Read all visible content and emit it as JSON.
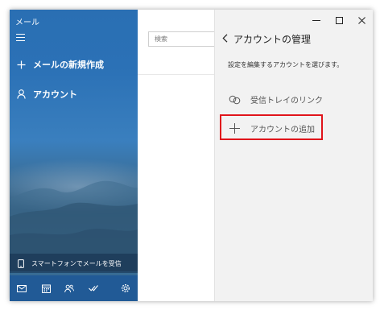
{
  "app": {
    "title": "メール"
  },
  "nav": {
    "compose_label": "メールの新規作成",
    "accounts_label": "アカウント",
    "phone_banner_label": "スマートフォンでメールを受信"
  },
  "search": {
    "placeholder": "検索"
  },
  "flyout": {
    "title": "アカウントの管理",
    "instruction": "設定を編集するアカウントを選びます。",
    "link_inboxes_label": "受信トレイのリンク",
    "add_account_label": "アカウントの追加"
  },
  "window_controls": {
    "minimize": "—",
    "maximize": "☐",
    "close": "✕"
  },
  "colors": {
    "nav_blue": "#2a6fb3",
    "bottom_bar": "#215a96",
    "flyout_bg": "#f2f2f2",
    "highlight_red": "#e0141b"
  },
  "icons": {
    "hamburger": "hamburger-icon",
    "compose": "plus-icon",
    "accounts": "person-icon",
    "phone": "phone-icon",
    "mail": "mail-icon",
    "calendar": "calendar-icon",
    "people": "people-icon",
    "todo": "todo-check-icon",
    "settings": "gear-icon",
    "back": "chevron-left-icon",
    "link": "link-icon",
    "add": "plus-icon"
  }
}
